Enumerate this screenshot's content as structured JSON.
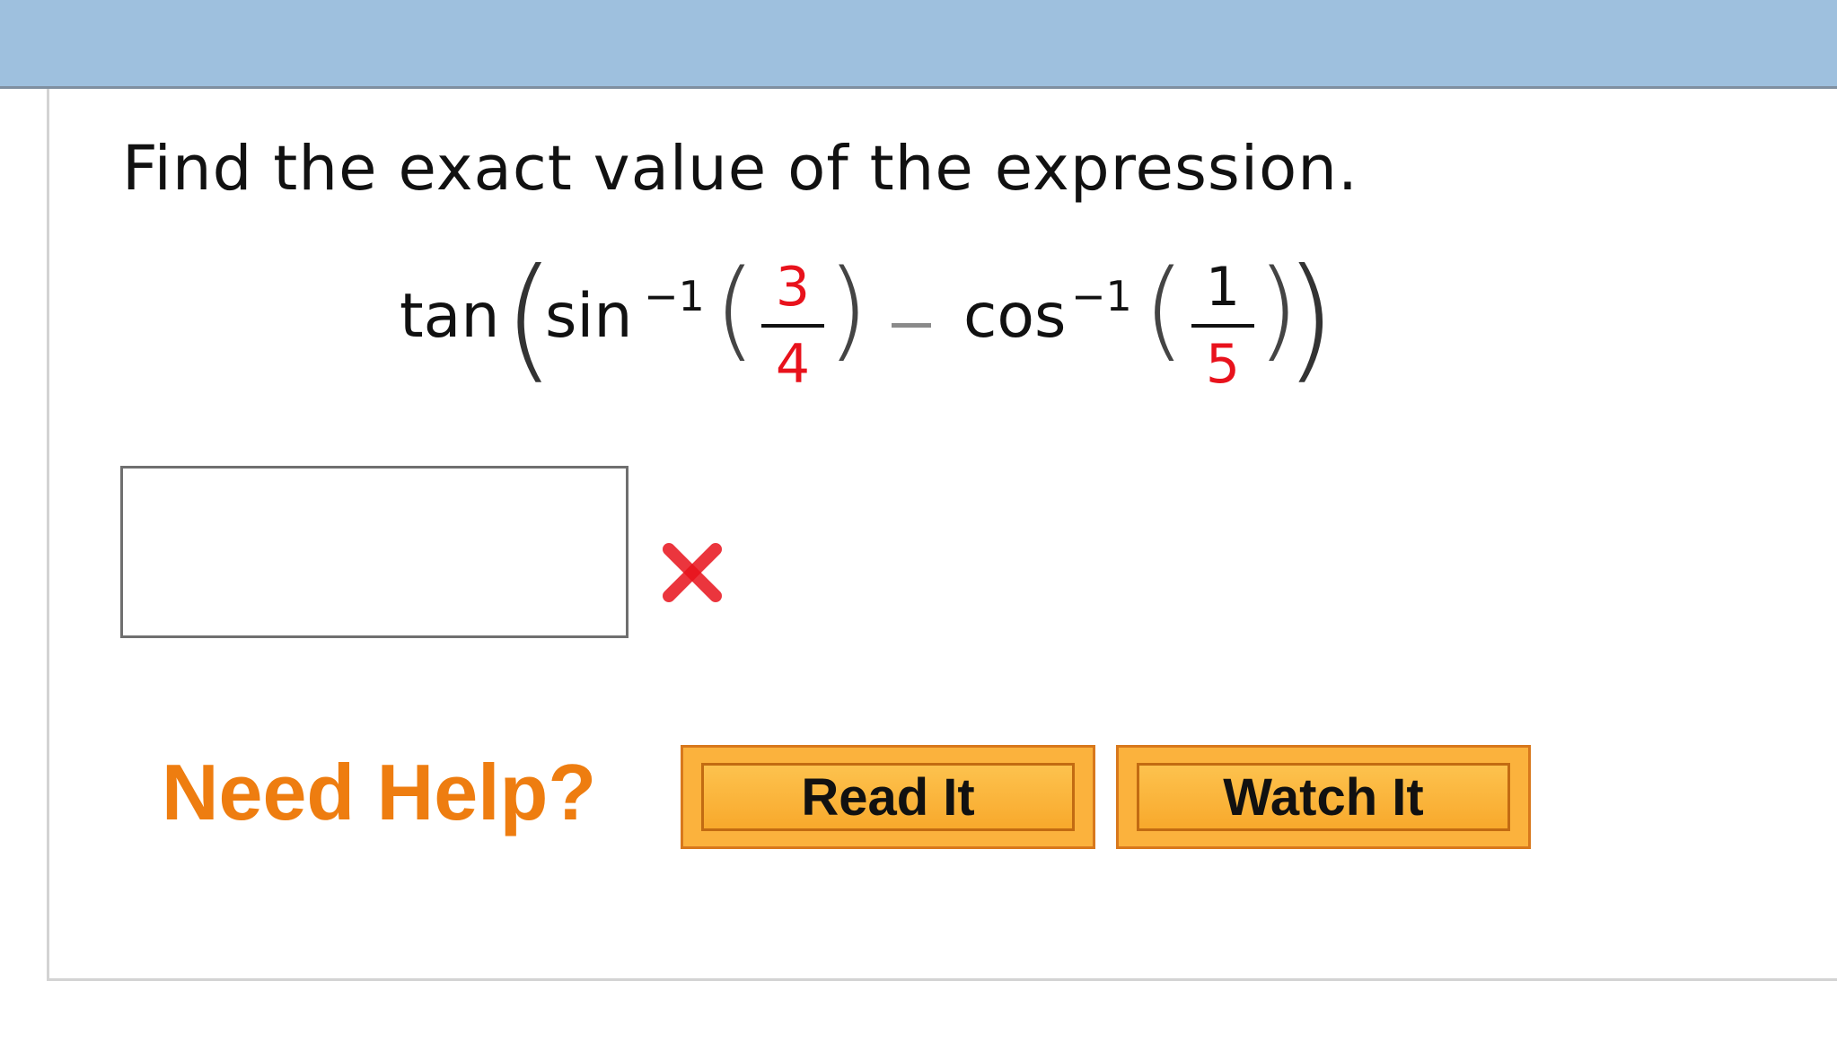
{
  "header": {
    "bar_color": "#9ec0de"
  },
  "question": {
    "prompt": "Find the exact value of the expression.",
    "expression": {
      "outer_fn": "tan",
      "fn1": "sin",
      "fn1_exponent": "−1",
      "frac1_num": "3",
      "frac1_den": "4",
      "operator": "−",
      "fn2": "cos",
      "fn2_exponent": "−1",
      "frac2_num": "1",
      "frac2_den": "5",
      "highlight_color": "#e8121c"
    }
  },
  "answer": {
    "value": "",
    "placeholder": "",
    "status_icon": "incorrect-x-icon",
    "status_color": "#e8121c"
  },
  "help": {
    "label": "Need Help?",
    "read_button": "Read It",
    "watch_button": "Watch It",
    "accent_color": "#ee7d10"
  }
}
